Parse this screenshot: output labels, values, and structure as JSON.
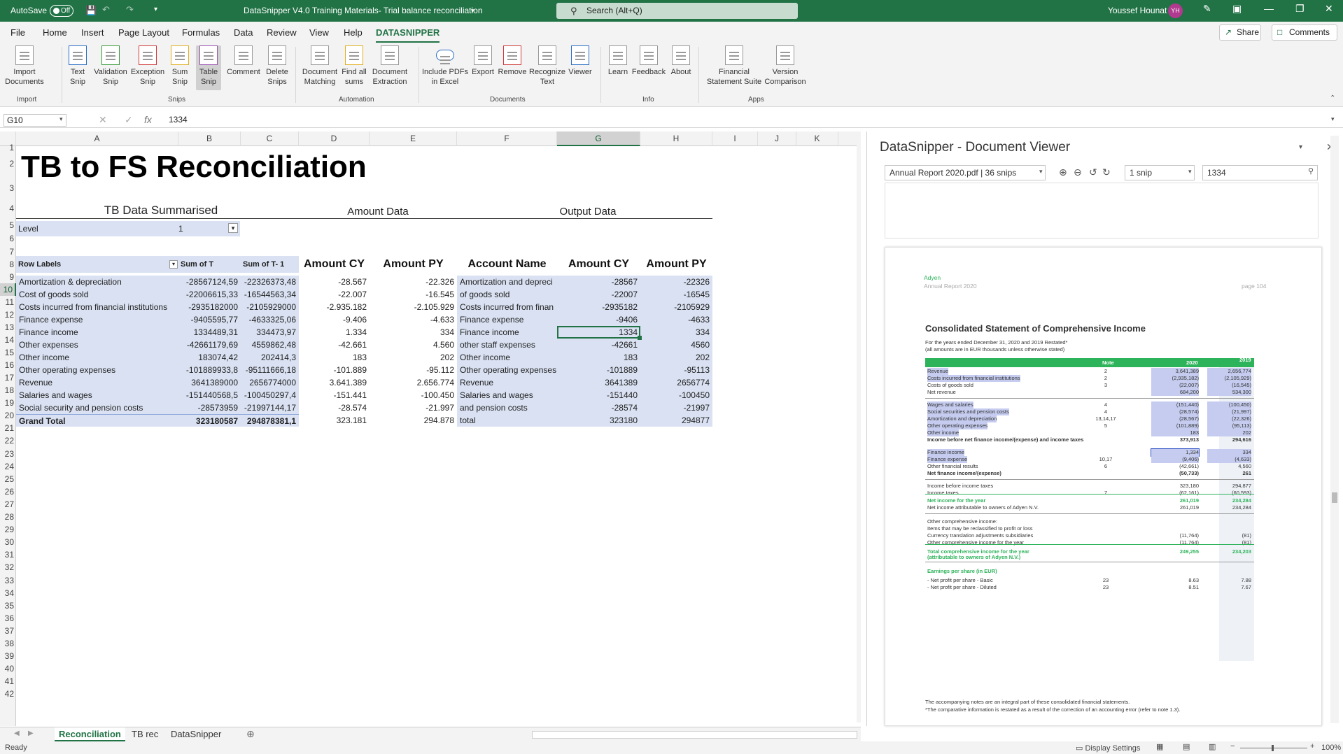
{
  "titlebar": {
    "autosave": "AutoSave",
    "autosave_state": "Off",
    "doc_title": "DataSnipper V4.0 Training Materials- Trial balance reconciliation",
    "search_placeholder": "Search (Alt+Q)",
    "user": "Youssef Hounat",
    "initials": "YH"
  },
  "menu": {
    "tabs": [
      "File",
      "Home",
      "Insert",
      "Page Layout",
      "Formulas",
      "Data",
      "Review",
      "View",
      "Help",
      "DATASNIPPER"
    ],
    "share": "Share",
    "comments": "Comments"
  },
  "ribbon": {
    "buttons": [
      "Import Documents",
      "Text Snip",
      "Validation Snip",
      "Exception Snip",
      "Sum Snip",
      "Table Snip",
      "Comment",
      "Delete Snips",
      "Document Matching",
      "Find all sums",
      "Document Extraction",
      "Include PDFs in Excel",
      "Export",
      "Remove",
      "Recognize Text",
      "Viewer",
      "Learn",
      "Feedback",
      "About",
      "Financial Statement Suite",
      "Version Comparison"
    ],
    "groups": [
      "Import",
      "Snips",
      "Automation",
      "Documents",
      "Info",
      "Apps"
    ]
  },
  "formula": {
    "namebox": "G10",
    "fx": "fx",
    "value": "1334"
  },
  "columns": [
    "A",
    "B",
    "C",
    "D",
    "E",
    "F",
    "G",
    "H",
    "I",
    "J",
    "K"
  ],
  "sheet": {
    "title": "TB to FS Reconciliation",
    "sections": [
      "TB Data Summarised",
      "Amount Data",
      "Output Data"
    ],
    "level_label": "Level",
    "level_value": "1",
    "headers": [
      "Row Labels",
      "Sum of T",
      "Sum of T- 1",
      "Amount CY",
      "Amount PY",
      "Account Name",
      "Amount CY",
      "Amount PY"
    ],
    "rows": [
      [
        "Amortization & depreciation",
        "-28567124,59",
        "-22326373,48",
        "-28.567",
        "-22.326",
        "Amortization and depreci",
        "-28567",
        "-22326"
      ],
      [
        "Cost of goods sold",
        "-22006615,33",
        "-16544563,34",
        "-22.007",
        "-16.545",
        "of goods sold",
        "-22007",
        "-16545"
      ],
      [
        "Costs incurred from financial institutions",
        "-2935182000",
        "-2105929000",
        "-2.935.182",
        "-2.105.929",
        "Costs incurred from finan",
        "-2935182",
        "-2105929"
      ],
      [
        "Finance expense",
        "-9405595,77",
        "-4633325,06",
        "-9.406",
        "-4.633",
        "Finance expense",
        "-9406",
        "-4633"
      ],
      [
        "Finance income",
        "1334489,31",
        "334473,97",
        "1.334",
        "334",
        "Finance income",
        "1334",
        "334"
      ],
      [
        "Other expenses",
        "-42661179,69",
        "4559862,48",
        "-42.661",
        "4.560",
        "other staff expenses",
        "-42661",
        "4560"
      ],
      [
        "Other income",
        "183074,42",
        "202414,3",
        "183",
        "202",
        "Other income",
        "183",
        "202"
      ],
      [
        "Other operating expenses",
        "-101889933,8",
        "-95111666,18",
        "-101.889",
        "-95.112",
        "Other operating expenses",
        "-101889",
        "-95113"
      ],
      [
        "Revenue",
        "3641389000",
        "2656774000",
        "3.641.389",
        "2.656.774",
        "Revenue",
        "3641389",
        "2656774"
      ],
      [
        "Salaries and wages",
        "-151440568,5",
        "-100450297,4",
        "-151.441",
        "-100.450",
        "Salaries and wages",
        "-151440",
        "-100450"
      ],
      [
        "Social security and pension costs",
        "-28573959",
        "-21997144,17",
        "-28.574",
        "-21.997",
        "and pension costs",
        "-28574",
        "-21997"
      ],
      [
        "Grand Total",
        "323180587",
        "294878381,1",
        "323.181",
        "294.878",
        "total",
        "323180",
        "294877"
      ]
    ]
  },
  "sheet_tabs": [
    "Reconciliation",
    "TB rec",
    "DataSnipper"
  ],
  "status": {
    "ready": "Ready",
    "display_settings": "Display Settings",
    "zoom": "100%"
  },
  "viewer": {
    "title": "DataSnipper - Document Viewer",
    "doc_select": "Annual Report 2020.pdf | 36 snips",
    "snip_select": "1 snip",
    "search_value": "1334",
    "doc": {
      "company": "Adyen",
      "report": "Annual Report 2020",
      "page": "page 104",
      "heading": "Consolidated Statement of Comprehensive Income",
      "sub1": "For the years ended December 31, 2020 and 2019 Restated*",
      "sub2": "(all amounts are in EUR thousands unless otherwise stated)",
      "col_note": "Note",
      "col_2020": "2020",
      "col_2019": "2019",
      "col_2019b": "Restated*",
      "lines": [
        [
          "Revenue",
          "2",
          "3,641,389",
          "2,656,774"
        ],
        [
          "Costs incurred from financial institutions",
          "2",
          "(2,935,182)",
          "(2,105,929)"
        ],
        [
          "Costs of goods sold",
          "3",
          "(22,007)",
          "(16,545)"
        ],
        [
          "Net revenue",
          "",
          "684,200",
          "534,300"
        ],
        [
          "Wages and salaries",
          "4",
          "(151,440)",
          "(100,450)"
        ],
        [
          "Social securities and pension costs",
          "4",
          "(28,574)",
          "(21,997)"
        ],
        [
          "Amortization and depreciation",
          "13,14,17",
          "(28,567)",
          "(22,326)"
        ],
        [
          "Other operating expenses",
          "5",
          "(101,889)",
          "(95,113)"
        ],
        [
          "Other income",
          "",
          "183",
          "202"
        ],
        [
          "Income before net finance income/(expense) and income taxes",
          "",
          "373,913",
          "294,616"
        ],
        [
          "Finance income",
          "",
          "1,334",
          "334"
        ],
        [
          "Finance expense",
          "10,17",
          "(9,406)",
          "(4,633)"
        ],
        [
          "Other financial results",
          "6",
          "(42,661)",
          "4,560"
        ],
        [
          "Net finance income/(expense)",
          "",
          "(50,733)",
          "261"
        ],
        [
          "Income before income taxes",
          "",
          "323,180",
          "294,877"
        ],
        [
          "Income taxes",
          "7",
          "(62,161)",
          "(60,593)"
        ],
        [
          "Net income for the year",
          "",
          "261,019",
          "234,284"
        ],
        [
          "Net income attributable to owners of Adyen N.V.",
          "",
          "261,019",
          "234,284"
        ],
        [
          "Other comprehensive income:",
          "",
          "",
          ""
        ],
        [
          "Items that may be reclassified to profit or loss",
          "",
          "",
          ""
        ],
        [
          "Currency translation adjustments subsidiaries",
          "",
          "(11,764)",
          "(81)"
        ],
        [
          "Other comprehensive income for the year",
          "",
          "(11,764)",
          "(81)"
        ],
        [
          "Total comprehensive income for the year",
          "",
          "249,255",
          "234,203"
        ],
        [
          "(attributable to owners of Adyen N.V.)",
          "",
          "",
          ""
        ],
        [
          "Earnings per share (in EUR)",
          "",
          "",
          ""
        ],
        [
          "- Net profit per share - Basic",
          "23",
          "8.63",
          "7.88"
        ],
        [
          "- Net profit per share - Diluted",
          "23",
          "8.51",
          "7.67"
        ]
      ],
      "foot1": "The accompanying notes are an integral part of these consolidated financial statements.",
      "foot2": "*The comparative information is restated as a result of the correction of an accounting error (refer to note 1.3)."
    }
  },
  "colors": {
    "excel_green": "#217346",
    "pivot_blue": "#d9e1f2",
    "doc_green": "#2db35a",
    "snip_highlight": "#c5ccef"
  }
}
